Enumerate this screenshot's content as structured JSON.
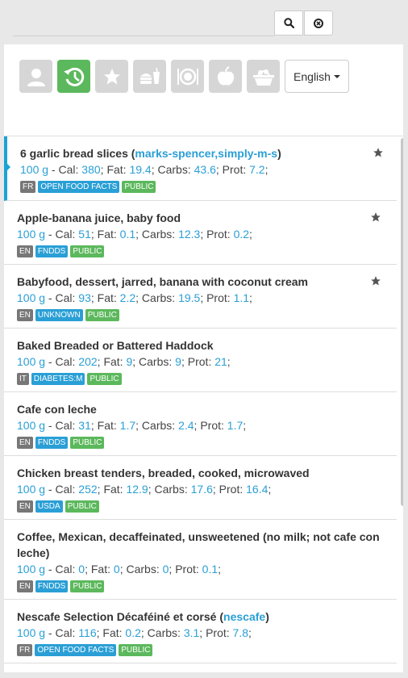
{
  "search": {
    "value": "",
    "placeholder": ""
  },
  "search_icon": "search-icon",
  "clear_icon": "close-circle-icon",
  "categories": [
    "user-icon",
    "history-icon",
    "star-icon",
    "fastfood-icon",
    "dish-icon",
    "apple-icon",
    "basket-icon"
  ],
  "language": {
    "selected": "English"
  },
  "colors": {
    "accent": "#5cb85c",
    "link": "#2a9fd6",
    "selected_border": "#1aa3d4"
  },
  "foods": [
    {
      "name": "6 garlic bread slices",
      "brand": "marks-spencer,simply-m-s",
      "qty": "100 g",
      "cal": "380",
      "fat": "19.4",
      "carbs": "43.6",
      "prot": "7.2",
      "lang": "FR",
      "source": "OPEN FOOD FACTS",
      "visibility": "PUBLIC",
      "starred": true
    },
    {
      "name": "Apple-banana juice, baby food",
      "brand": "",
      "qty": "100 g",
      "cal": "51",
      "fat": "0.1",
      "carbs": "12.3",
      "prot": "0.2",
      "lang": "EN",
      "source": "FNDDS",
      "visibility": "PUBLIC",
      "starred": true
    },
    {
      "name": "Babyfood, dessert, jarred, banana with coconut cream",
      "brand": "",
      "qty": "100 g",
      "cal": "93",
      "fat": "2.2",
      "carbs": "19.5",
      "prot": "1.1",
      "lang": "EN",
      "source": "UNKNOWN",
      "visibility": "PUBLIC",
      "starred": true
    },
    {
      "name": "Baked Breaded or Battered Haddock",
      "brand": "",
      "qty": "100 g",
      "cal": "202",
      "fat": "9",
      "carbs": "9",
      "prot": "21",
      "lang": "IT",
      "source": "DIABETES:M",
      "visibility": "PUBLIC",
      "starred": false
    },
    {
      "name": "Cafe con leche",
      "brand": "",
      "qty": "100 g",
      "cal": "31",
      "fat": "1.7",
      "carbs": "2.4",
      "prot": "1.7",
      "lang": "EN",
      "source": "FNDDS",
      "visibility": "PUBLIC",
      "starred": false
    },
    {
      "name": "Chicken breast tenders, breaded, cooked, microwaved",
      "brand": "",
      "qty": "100 g",
      "cal": "252",
      "fat": "12.9",
      "carbs": "17.6",
      "prot": "16.4",
      "lang": "EN",
      "source": "USDA",
      "visibility": "PUBLIC",
      "starred": false
    },
    {
      "name": "Coffee, Mexican, decaffeinated, unsweetened (no milk; not cafe con leche)",
      "brand": "",
      "qty": "100 g",
      "cal": "0",
      "fat": "0",
      "carbs": "0",
      "prot": "0.1",
      "lang": "EN",
      "source": "FNDDS",
      "visibility": "PUBLIC",
      "starred": false
    },
    {
      "name": "Nescafe Selection Décaféiné et corsé",
      "brand": "nescafe",
      "qty": "100 g",
      "cal": "116",
      "fat": "0.2",
      "carbs": "3.1",
      "prot": "7.8",
      "lang": "FR",
      "source": "OPEN FOOD FACTS",
      "visibility": "PUBLIC",
      "starred": false
    }
  ],
  "labels": {
    "cal": "Cal",
    "fat": "Fat",
    "carbs": "Carbs",
    "prot": "Prot"
  }
}
